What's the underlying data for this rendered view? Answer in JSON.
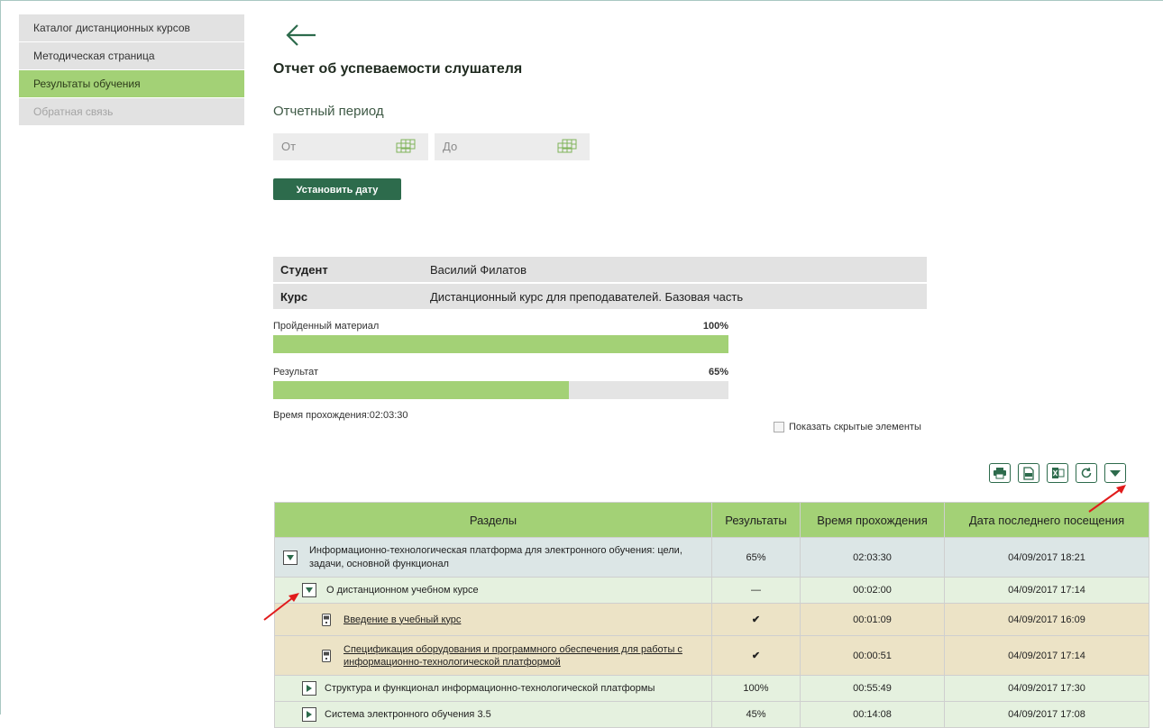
{
  "sidebar": {
    "items": [
      {
        "label": "Каталог дистанционных курсов"
      },
      {
        "label": "Методическая страница"
      },
      {
        "label": "Результаты обучения"
      },
      {
        "label": "Обратная связь"
      }
    ]
  },
  "page": {
    "title": "Отчет об успеваемости слушателя",
    "period_label": "Отчетный период",
    "from_placeholder": "От",
    "to_placeholder": "До",
    "set_date_button": "Установить дату"
  },
  "info": {
    "student_key": "Студент",
    "student_value": "Василий Филатов",
    "course_key": "Курс",
    "course_value": "Дистанционный курс для преподавателей. Базовая часть"
  },
  "progress": {
    "material_label": "Пройденный материал",
    "material_pct_text": "100%",
    "material_value": 1.0,
    "result_label": "Результат",
    "result_pct_text": "65%",
    "result_value": 0.65,
    "time_text": "Время прохождения:02:03:30"
  },
  "show_hidden_label": "Показать скрытые элементы",
  "toolbar": {
    "icons": [
      "print-icon",
      "pdf-icon",
      "excel-icon",
      "refresh-icon",
      "dropdown-icon"
    ]
  },
  "table": {
    "headers": [
      "Разделы",
      "Результаты",
      "Время прохождения",
      "Дата последнего посещения"
    ],
    "rows": [
      {
        "title": "Информационно-технологическая платформа для электронного обучения: цели, задачи, основной функционал",
        "result": "65%",
        "time": "02:03:30",
        "date": "04/09/2017 18:21"
      },
      {
        "title": "О дистанционном учебном курсе",
        "result": "—",
        "time": "00:02:00",
        "date": "04/09/2017 17:14"
      },
      {
        "title": "Введение в учебный курс",
        "result": "✔",
        "time": "00:01:09",
        "date": "04/09/2017 16:09"
      },
      {
        "title": "Спецификация оборудования и программного обеспечения для работы с информационно-технологической платформой",
        "result": "✔",
        "time": "00:00:51",
        "date": "04/09/2017 17:14"
      },
      {
        "title": "Структура и функционал информационно-технологической платформы",
        "result": "100%",
        "time": "00:55:49",
        "date": "04/09/2017 17:30"
      },
      {
        "title": "Система электронного обучения 3.5",
        "result": "45%",
        "time": "00:14:08",
        "date": "04/09/2017 17:08"
      }
    ]
  },
  "colors": {
    "accent_green": "#a3d176",
    "dark_green": "#2d6b4c",
    "annotation_red": "#e11b1b"
  }
}
